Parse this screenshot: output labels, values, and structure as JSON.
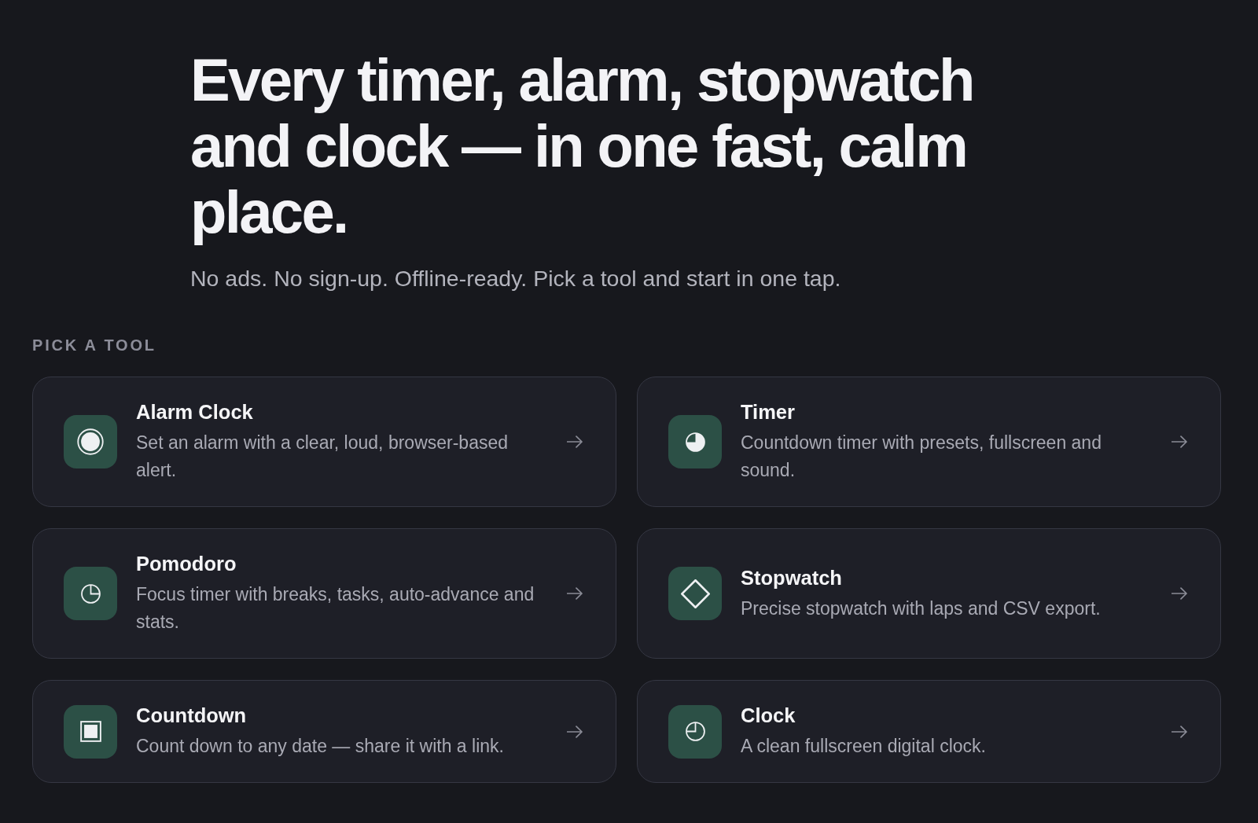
{
  "hero": {
    "heading": "Every timer, alarm, stopwatch and clock — in one fast, calm place.",
    "subheading": "No ads. No sign-up. Offline-ready. Pick a tool and start in one tap."
  },
  "tools_section": {
    "label": "PICK A TOOL",
    "tools": [
      {
        "title": "Alarm Clock",
        "description": "Set an alarm with a clear, loud, browser-based alert."
      },
      {
        "title": "Timer",
        "description": "Countdown timer with presets, fullscreen and sound."
      },
      {
        "title": "Pomodoro",
        "description": "Focus timer with breaks, tasks, auto-advance and stats."
      },
      {
        "title": "Stopwatch",
        "description": "Precise stopwatch with laps and CSV export."
      },
      {
        "title": "Countdown",
        "description": "Count down to any date — share it with a link."
      },
      {
        "title": "Clock",
        "description": "A clean fullscreen digital clock."
      }
    ]
  }
}
